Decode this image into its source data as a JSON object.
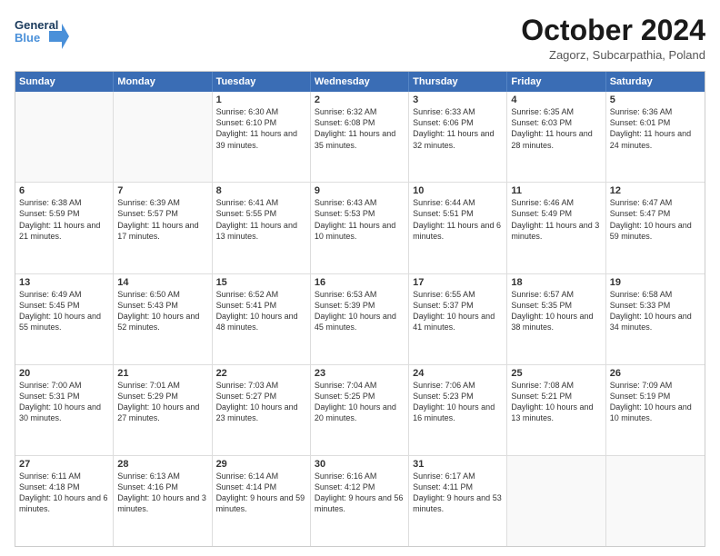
{
  "header": {
    "logo_line1": "General",
    "logo_line2": "Blue",
    "month": "October 2024",
    "location": "Zagorz, Subcarpathia, Poland"
  },
  "weekdays": [
    "Sunday",
    "Monday",
    "Tuesday",
    "Wednesday",
    "Thursday",
    "Friday",
    "Saturday"
  ],
  "rows": [
    [
      {
        "day": "",
        "text": "",
        "empty": true
      },
      {
        "day": "",
        "text": "",
        "empty": true
      },
      {
        "day": "1",
        "text": "Sunrise: 6:30 AM\nSunset: 6:10 PM\nDaylight: 11 hours and 39 minutes."
      },
      {
        "day": "2",
        "text": "Sunrise: 6:32 AM\nSunset: 6:08 PM\nDaylight: 11 hours and 35 minutes."
      },
      {
        "day": "3",
        "text": "Sunrise: 6:33 AM\nSunset: 6:06 PM\nDaylight: 11 hours and 32 minutes."
      },
      {
        "day": "4",
        "text": "Sunrise: 6:35 AM\nSunset: 6:03 PM\nDaylight: 11 hours and 28 minutes."
      },
      {
        "day": "5",
        "text": "Sunrise: 6:36 AM\nSunset: 6:01 PM\nDaylight: 11 hours and 24 minutes."
      }
    ],
    [
      {
        "day": "6",
        "text": "Sunrise: 6:38 AM\nSunset: 5:59 PM\nDaylight: 11 hours and 21 minutes."
      },
      {
        "day": "7",
        "text": "Sunrise: 6:39 AM\nSunset: 5:57 PM\nDaylight: 11 hours and 17 minutes."
      },
      {
        "day": "8",
        "text": "Sunrise: 6:41 AM\nSunset: 5:55 PM\nDaylight: 11 hours and 13 minutes."
      },
      {
        "day": "9",
        "text": "Sunrise: 6:43 AM\nSunset: 5:53 PM\nDaylight: 11 hours and 10 minutes."
      },
      {
        "day": "10",
        "text": "Sunrise: 6:44 AM\nSunset: 5:51 PM\nDaylight: 11 hours and 6 minutes."
      },
      {
        "day": "11",
        "text": "Sunrise: 6:46 AM\nSunset: 5:49 PM\nDaylight: 11 hours and 3 minutes."
      },
      {
        "day": "12",
        "text": "Sunrise: 6:47 AM\nSunset: 5:47 PM\nDaylight: 10 hours and 59 minutes."
      }
    ],
    [
      {
        "day": "13",
        "text": "Sunrise: 6:49 AM\nSunset: 5:45 PM\nDaylight: 10 hours and 55 minutes."
      },
      {
        "day": "14",
        "text": "Sunrise: 6:50 AM\nSunset: 5:43 PM\nDaylight: 10 hours and 52 minutes."
      },
      {
        "day": "15",
        "text": "Sunrise: 6:52 AM\nSunset: 5:41 PM\nDaylight: 10 hours and 48 minutes."
      },
      {
        "day": "16",
        "text": "Sunrise: 6:53 AM\nSunset: 5:39 PM\nDaylight: 10 hours and 45 minutes."
      },
      {
        "day": "17",
        "text": "Sunrise: 6:55 AM\nSunset: 5:37 PM\nDaylight: 10 hours and 41 minutes."
      },
      {
        "day": "18",
        "text": "Sunrise: 6:57 AM\nSunset: 5:35 PM\nDaylight: 10 hours and 38 minutes."
      },
      {
        "day": "19",
        "text": "Sunrise: 6:58 AM\nSunset: 5:33 PM\nDaylight: 10 hours and 34 minutes."
      }
    ],
    [
      {
        "day": "20",
        "text": "Sunrise: 7:00 AM\nSunset: 5:31 PM\nDaylight: 10 hours and 30 minutes."
      },
      {
        "day": "21",
        "text": "Sunrise: 7:01 AM\nSunset: 5:29 PM\nDaylight: 10 hours and 27 minutes."
      },
      {
        "day": "22",
        "text": "Sunrise: 7:03 AM\nSunset: 5:27 PM\nDaylight: 10 hours and 23 minutes."
      },
      {
        "day": "23",
        "text": "Sunrise: 7:04 AM\nSunset: 5:25 PM\nDaylight: 10 hours and 20 minutes."
      },
      {
        "day": "24",
        "text": "Sunrise: 7:06 AM\nSunset: 5:23 PM\nDaylight: 10 hours and 16 minutes."
      },
      {
        "day": "25",
        "text": "Sunrise: 7:08 AM\nSunset: 5:21 PM\nDaylight: 10 hours and 13 minutes."
      },
      {
        "day": "26",
        "text": "Sunrise: 7:09 AM\nSunset: 5:19 PM\nDaylight: 10 hours and 10 minutes."
      }
    ],
    [
      {
        "day": "27",
        "text": "Sunrise: 6:11 AM\nSunset: 4:18 PM\nDaylight: 10 hours and 6 minutes."
      },
      {
        "day": "28",
        "text": "Sunrise: 6:13 AM\nSunset: 4:16 PM\nDaylight: 10 hours and 3 minutes."
      },
      {
        "day": "29",
        "text": "Sunrise: 6:14 AM\nSunset: 4:14 PM\nDaylight: 9 hours and 59 minutes."
      },
      {
        "day": "30",
        "text": "Sunrise: 6:16 AM\nSunset: 4:12 PM\nDaylight: 9 hours and 56 minutes."
      },
      {
        "day": "31",
        "text": "Sunrise: 6:17 AM\nSunset: 4:11 PM\nDaylight: 9 hours and 53 minutes."
      },
      {
        "day": "",
        "text": "",
        "empty": true
      },
      {
        "day": "",
        "text": "",
        "empty": true
      }
    ]
  ]
}
